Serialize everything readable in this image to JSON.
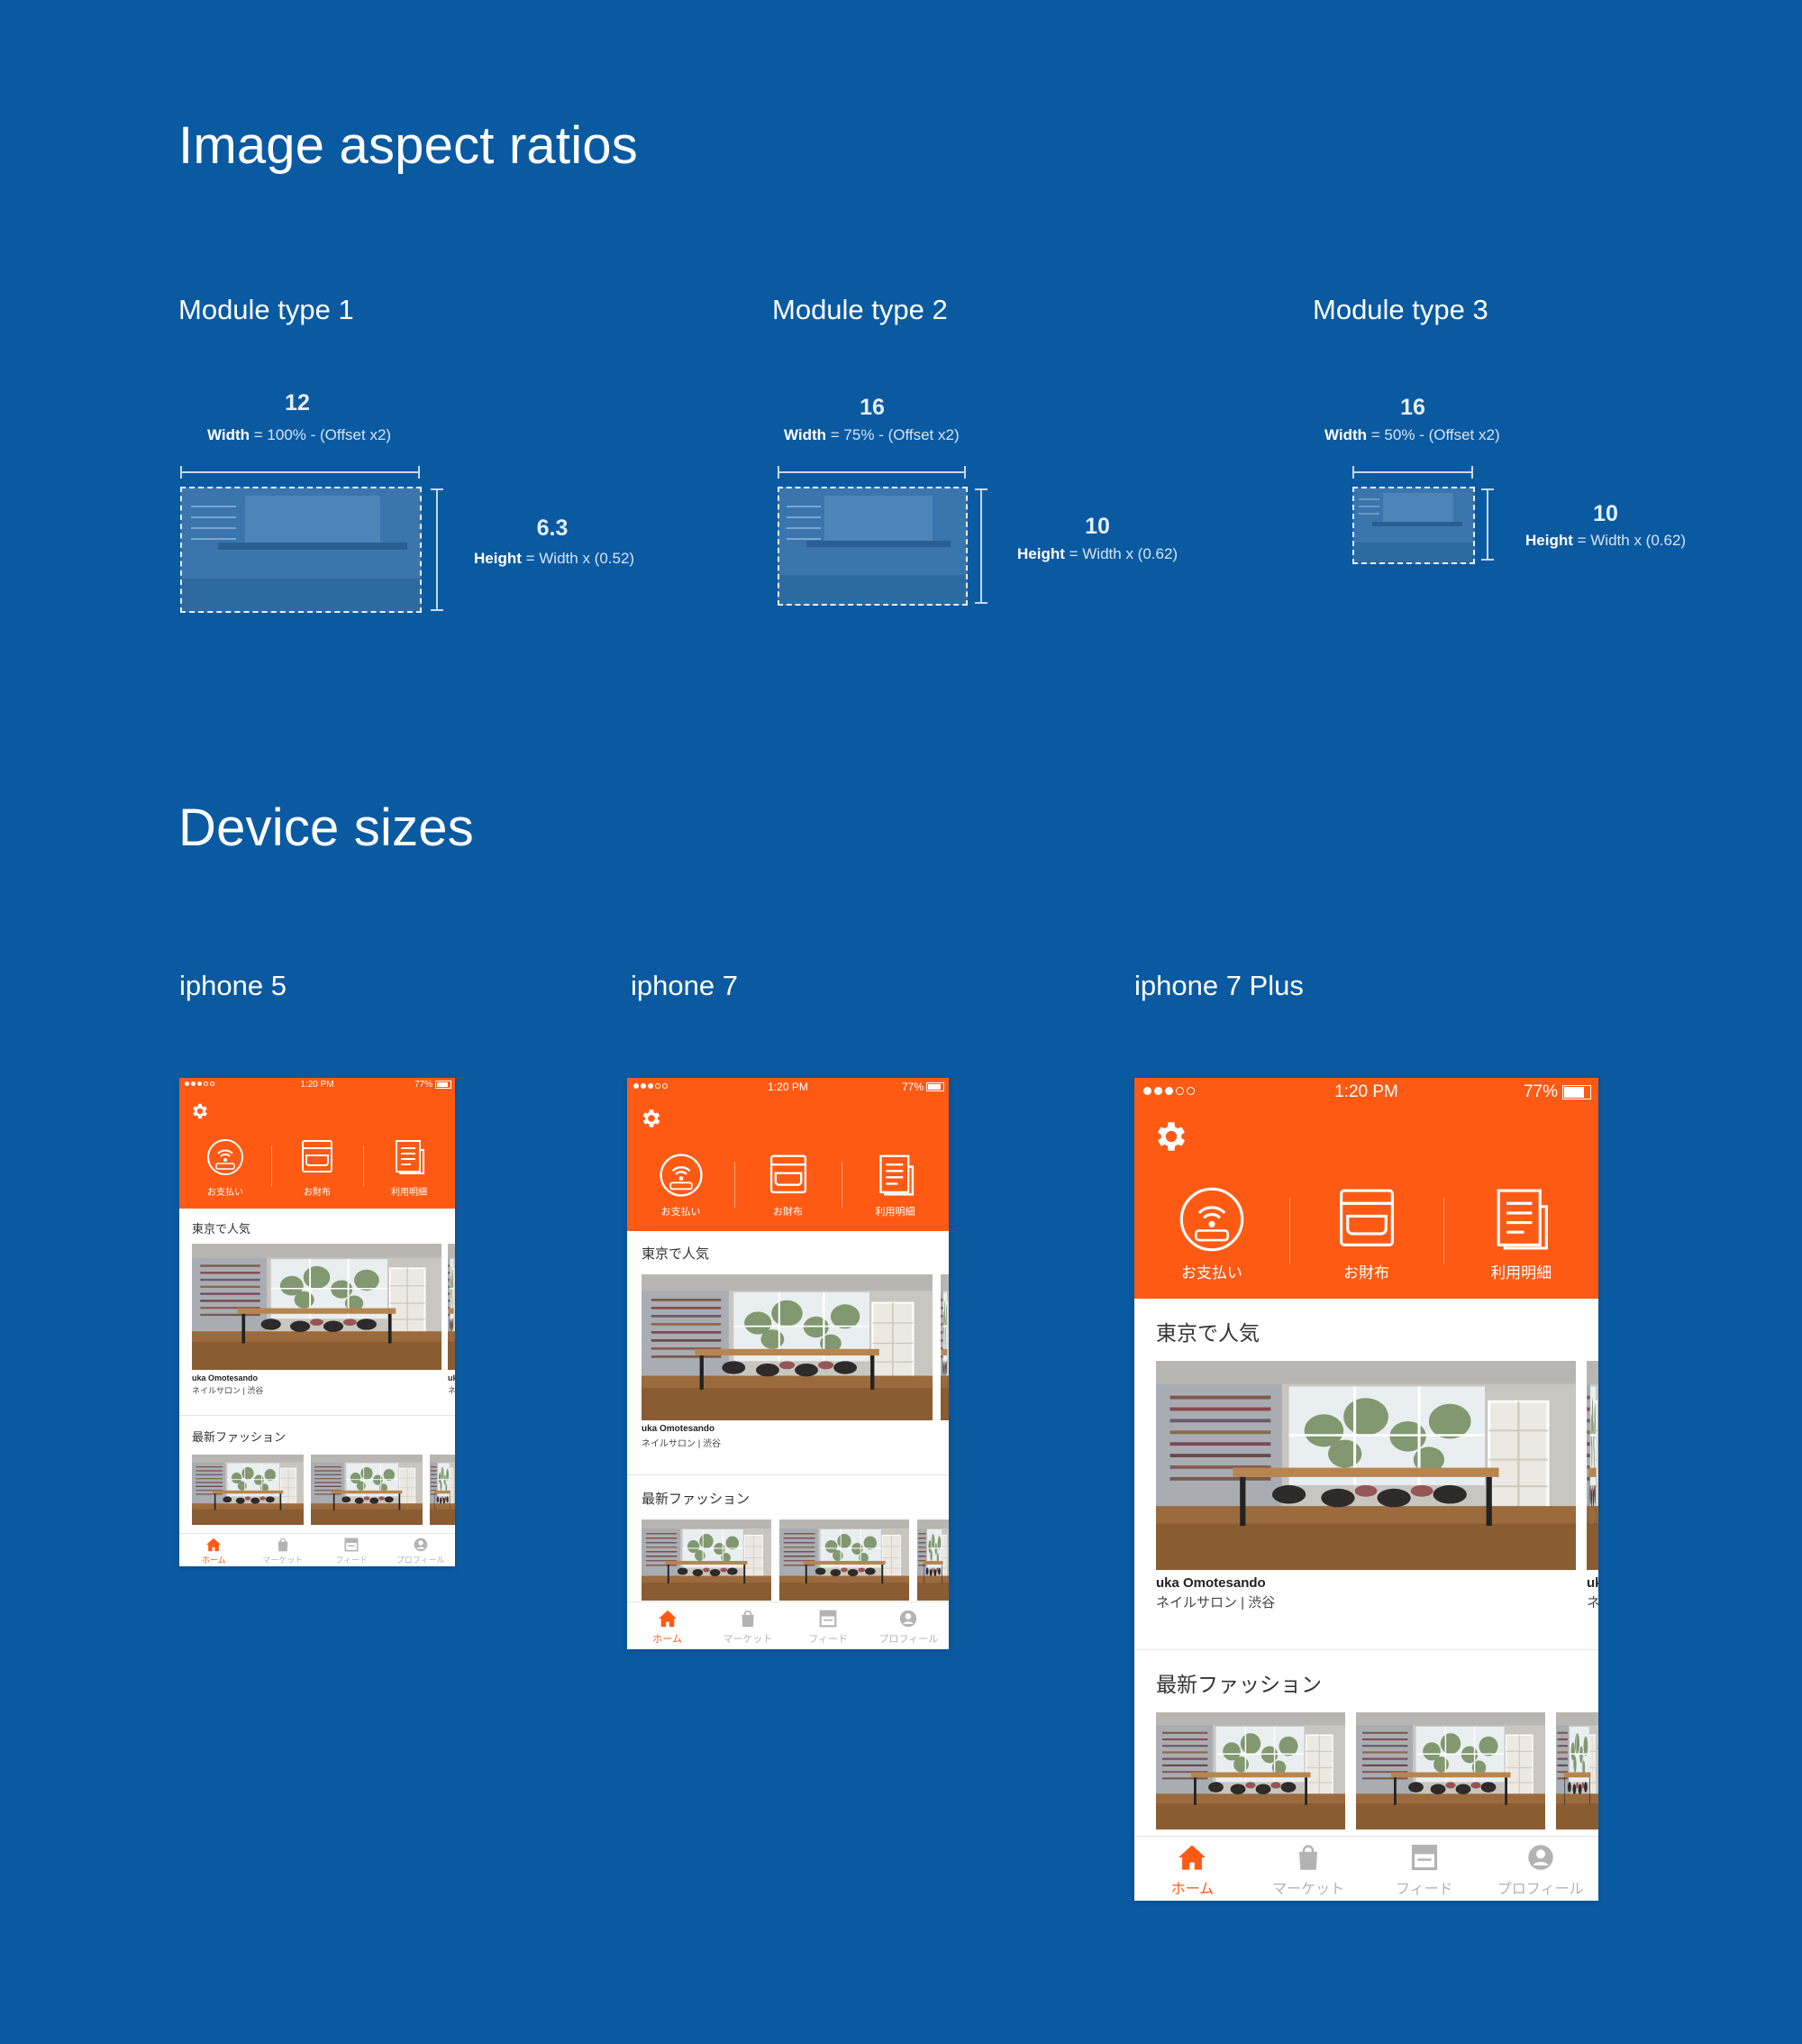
{
  "page": {
    "title": "Image aspect ratios",
    "title2": "Device sizes"
  },
  "modules": [
    {
      "title": "Module type 1",
      "ratio_w": "12",
      "width_label": "Width",
      "width_formula": " = 100% - (Offset x2)",
      "ratio_h": "6.3",
      "height_label": "Height",
      "height_formula": " = Width x (0.52)"
    },
    {
      "title": "Module type 2",
      "ratio_w": "16",
      "width_label": "Width",
      "width_formula": " = 75% - (Offset x2)",
      "ratio_h": "10",
      "height_label": "Height",
      "height_formula": " = Width x (0.62)"
    },
    {
      "title": "Module type 3",
      "ratio_w": "16",
      "width_label": "Width",
      "width_formula": " = 50% - (Offset x2)",
      "ratio_h": "10",
      "height_label": "Height",
      "height_formula": " = Width x (0.62)"
    }
  ],
  "devices": [
    {
      "title": "iphone 5"
    },
    {
      "title": "iphone 7"
    },
    {
      "title": "iphone 7 Plus"
    }
  ],
  "app": {
    "status_time": "1:20 PM",
    "battery": "77%",
    "quick_actions": [
      {
        "label": "お支払い",
        "icon": "payment-icon"
      },
      {
        "label": "お財布",
        "icon": "wallet-icon"
      },
      {
        "label": "利用明細",
        "icon": "statement-icon"
      }
    ],
    "section_popular": "東京で人気",
    "card_title": "uka Omotesando",
    "card_sub": "ネイルサロン | 渋谷",
    "card2_title": "uk",
    "card2_sub": "ネ",
    "section_fashion": "最新ファッション",
    "tabs": [
      {
        "label": "ホーム",
        "icon": "home-icon"
      },
      {
        "label": "マーケット",
        "icon": "bag-icon"
      },
      {
        "label": "フィード",
        "icon": "feed-icon"
      },
      {
        "label": "プロフィール",
        "icon": "profile-icon"
      }
    ]
  },
  "colors": {
    "background": "#0a5aa2",
    "accent": "#ff5a14"
  }
}
